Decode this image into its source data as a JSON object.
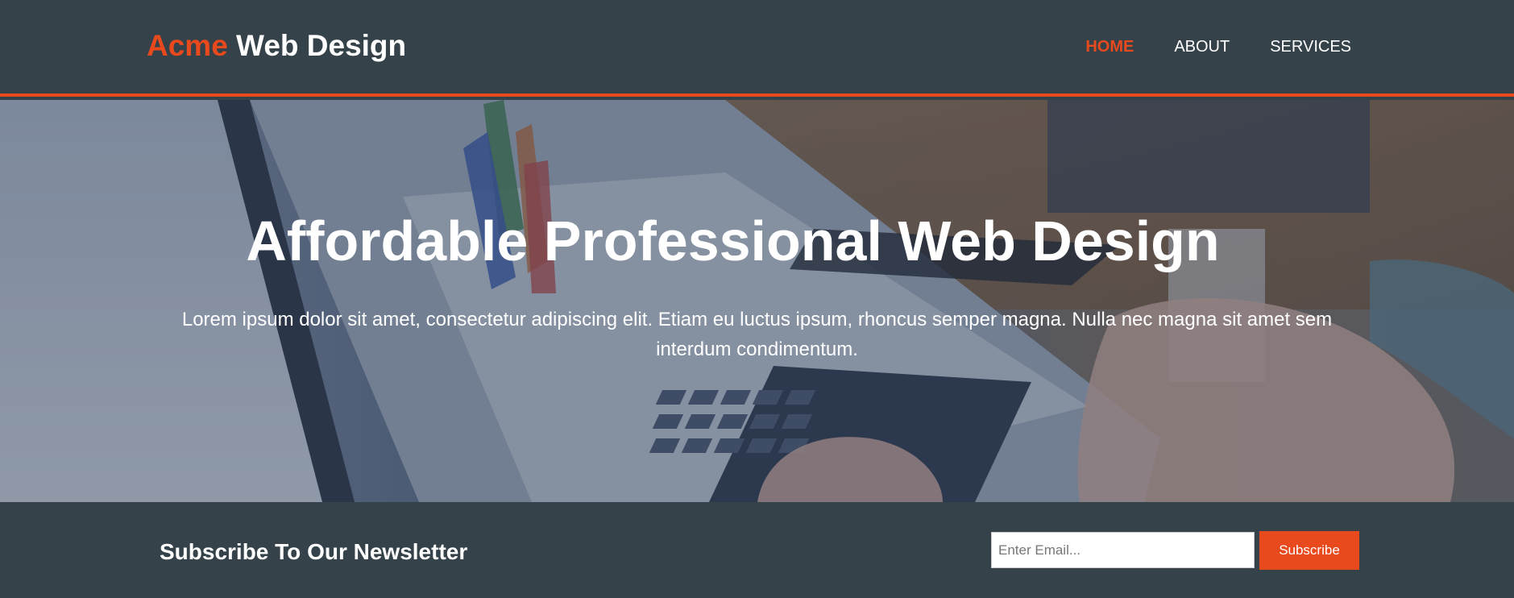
{
  "header": {
    "brand_highlight": "Acme",
    "brand_rest": " Web Design",
    "nav": [
      {
        "label": "HOME",
        "current": true
      },
      {
        "label": "ABOUT",
        "current": false
      },
      {
        "label": "SERVICES",
        "current": false
      }
    ]
  },
  "showcase": {
    "title": "Affordable Professional Web Design",
    "text": "Lorem ipsum dolor sit amet, consectetur adipiscing elit. Etiam eu luctus ipsum, rhoncus semper magna. Nulla nec magna sit amet sem interdum condimentum.",
    "background_icon": "laptop-photo"
  },
  "newsletter": {
    "title": "Subscribe To Our Newsletter",
    "email_placeholder": "Enter Email...",
    "email_value": "",
    "button_label": "Subscribe"
  },
  "colors": {
    "accent": "#e8491d",
    "dark": "#35424a",
    "text": "#ffffff"
  }
}
